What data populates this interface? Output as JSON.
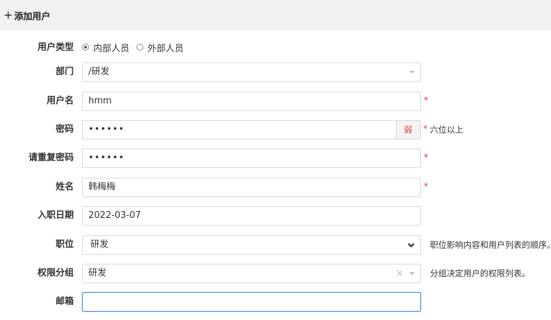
{
  "header": {
    "plus_icon": "+",
    "title": "添加用户"
  },
  "form": {
    "user_type": {
      "label": "用户类型",
      "options": [
        "内部人员",
        "外部人员"
      ],
      "selected": "内部人员"
    },
    "dept": {
      "label": "部门",
      "value": "/研发"
    },
    "username": {
      "label": "用户名",
      "value": "hmm",
      "required": "*"
    },
    "password": {
      "label": "密码",
      "value": "••••••",
      "required": "*",
      "strength": "弱",
      "hint": "六位以上"
    },
    "confirm_password": {
      "label": "请重复密码",
      "value": "••••••",
      "required": "*"
    },
    "realname": {
      "label": "姓名",
      "value": "韩梅梅",
      "required": "*"
    },
    "join_date": {
      "label": "入职日期",
      "value": "2022-03-07"
    },
    "role": {
      "label": "职位",
      "value": "研发",
      "hint": "职位影响内容和用户列表的顺序。"
    },
    "group": {
      "label": "权限分组",
      "value": "研发",
      "clear_icon": "×",
      "hint": "分组决定用户的权限列表。"
    },
    "email": {
      "label": "邮箱",
      "value": ""
    }
  },
  "colors": {
    "required": "#e03c3c",
    "focus": "#4a8ae6",
    "header_bg": "#f1f1f1"
  }
}
